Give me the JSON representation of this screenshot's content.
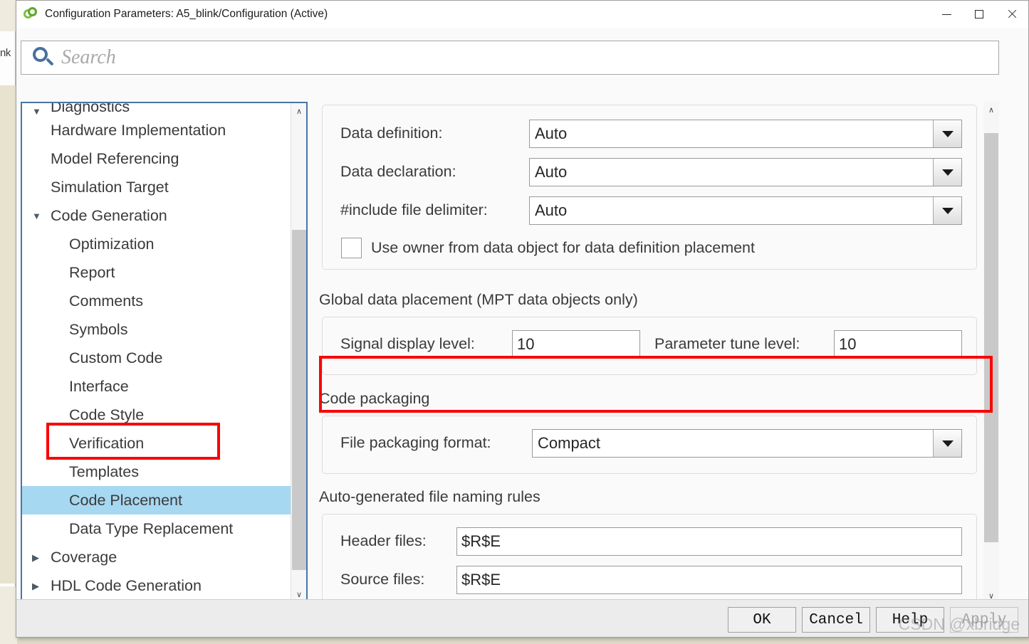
{
  "window": {
    "title": "Configuration Parameters: A5_blink/Configuration (Active)",
    "icon": "simulink-icon",
    "minimize_label": "–",
    "maximize_label": "□",
    "close_label": "✕"
  },
  "background": {
    "edge_label": "nk"
  },
  "search": {
    "placeholder": "Search",
    "value": "",
    "icon": "search-icon"
  },
  "sidebar": {
    "items": [
      {
        "label": "Diagnostics",
        "level": 1,
        "arrow": "▼",
        "clipped": true,
        "selected": false
      },
      {
        "label": "Hardware Implementation",
        "level": 1,
        "arrow": "",
        "clipped": false,
        "selected": false
      },
      {
        "label": "Model Referencing",
        "level": 1,
        "arrow": "",
        "clipped": false,
        "selected": false
      },
      {
        "label": "Simulation Target",
        "level": 1,
        "arrow": "",
        "clipped": false,
        "selected": false
      },
      {
        "label": "Code Generation",
        "level": 1,
        "arrow": "▼",
        "clipped": false,
        "selected": false
      },
      {
        "label": "Optimization",
        "level": 2,
        "arrow": "",
        "clipped": false,
        "selected": false
      },
      {
        "label": "Report",
        "level": 2,
        "arrow": "",
        "clipped": false,
        "selected": false
      },
      {
        "label": "Comments",
        "level": 2,
        "arrow": "",
        "clipped": false,
        "selected": false
      },
      {
        "label": "Symbols",
        "level": 2,
        "arrow": "",
        "clipped": false,
        "selected": false
      },
      {
        "label": "Custom Code",
        "level": 2,
        "arrow": "",
        "clipped": false,
        "selected": false
      },
      {
        "label": "Interface",
        "level": 2,
        "arrow": "",
        "clipped": false,
        "selected": false
      },
      {
        "label": "Code Style",
        "level": 2,
        "arrow": "",
        "clipped": false,
        "selected": false
      },
      {
        "label": "Verification",
        "level": 2,
        "arrow": "",
        "clipped": false,
        "selected": false
      },
      {
        "label": "Templates",
        "level": 2,
        "arrow": "",
        "clipped": false,
        "selected": false
      },
      {
        "label": "Code Placement",
        "level": 2,
        "arrow": "",
        "clipped": false,
        "selected": true
      },
      {
        "label": "Data Type Replacement",
        "level": 2,
        "arrow": "",
        "clipped": false,
        "selected": false
      },
      {
        "label": "Coverage",
        "level": 1,
        "arrow": "▶",
        "clipped": false,
        "selected": false
      },
      {
        "label": "HDL Code Generation",
        "level": 1,
        "arrow": "▶",
        "clipped": false,
        "selected": false
      }
    ],
    "scroll_up": "∧",
    "scroll_down": "∨"
  },
  "main": {
    "data_placement": {
      "data_definition_label": "Data definition:",
      "data_definition_value": "Auto",
      "data_declaration_label": "Data declaration:",
      "data_declaration_value": "Auto",
      "include_delimiter_label": "#include file delimiter:",
      "include_delimiter_value": "Auto",
      "use_owner_label": "Use owner from data object for data definition placement",
      "use_owner_checked": false
    },
    "global_data_placement": {
      "title": "Global data placement (MPT data objects only)",
      "signal_display_label": "Signal display level:",
      "signal_display_value": "10",
      "parameter_tune_label": "Parameter tune level:",
      "parameter_tune_value": "10"
    },
    "code_packaging": {
      "title": "Code packaging",
      "file_packaging_label": "File packaging format:",
      "file_packaging_value": "Compact"
    },
    "file_naming": {
      "title": "Auto-generated file naming rules",
      "header_files_label": "Header files:",
      "header_files_value": "$R$E",
      "source_files_label": "Source files:",
      "source_files_value": "$R$E"
    }
  },
  "footer": {
    "ok_label": "OK",
    "cancel_label": "Cancel",
    "help_label": "Help",
    "apply_label": "Apply",
    "apply_disabled": true,
    "watermark": "CSDN @xbridge"
  },
  "colors": {
    "annotation": "#fb0303",
    "selection": "#a7d8f2",
    "focus_border": "#4876a8",
    "accent_icon": "#4a6f9e"
  }
}
